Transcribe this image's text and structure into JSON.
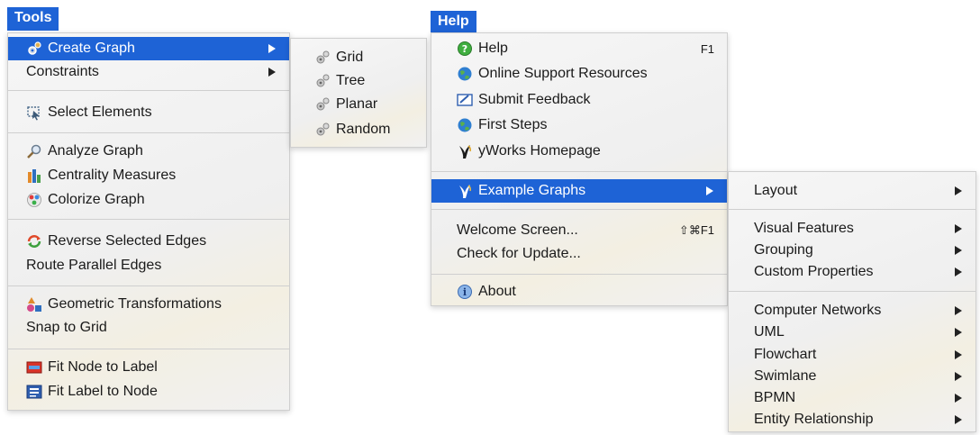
{
  "tools_menu": {
    "title": "Tools",
    "items": [
      {
        "label": "Create Graph",
        "icon": "gears-icon"
      },
      {
        "label": "Constraints"
      },
      {
        "label": "Select Elements",
        "icon": "select-icon"
      },
      {
        "label": "Analyze Graph",
        "icon": "magnifier-icon"
      },
      {
        "label": "Centrality Measures",
        "icon": "bars-icon"
      },
      {
        "label": "Colorize Graph",
        "icon": "palette-icon"
      },
      {
        "label": "Reverse Selected Edges",
        "icon": "reverse-icon"
      },
      {
        "label": "Route Parallel Edges"
      },
      {
        "label": "Geometric Transformations",
        "icon": "shapes-icon"
      },
      {
        "label": "Snap to Grid"
      },
      {
        "label": "Fit Node to Label",
        "icon": "fit-node-icon"
      },
      {
        "label": "Fit Label to Node",
        "icon": "fit-label-icon"
      }
    ]
  },
  "create_graph_submenu": {
    "items": [
      {
        "label": "Grid"
      },
      {
        "label": "Tree"
      },
      {
        "label": "Planar"
      },
      {
        "label": "Random"
      }
    ]
  },
  "help_menu": {
    "title": "Help",
    "items": [
      {
        "label": "Help",
        "shortcut": "F1",
        "icon": "help-icon"
      },
      {
        "label": "Online Support Resources",
        "icon": "globe-icon"
      },
      {
        "label": "Submit Feedback",
        "icon": "feedback-icon"
      },
      {
        "label": "First Steps",
        "icon": "globe-icon"
      },
      {
        "label": "yWorks Homepage",
        "icon": "yworks-logo-icon"
      },
      {
        "label": "Example Graphs",
        "icon": "yworks-logo-icon"
      },
      {
        "label": "Welcome Screen...",
        "shortcut": "⇧⌘F1"
      },
      {
        "label": "Check for Update..."
      },
      {
        "label": "About",
        "icon": "info-icon"
      }
    ]
  },
  "example_graphs_submenu": {
    "items": [
      {
        "label": "Layout"
      },
      {
        "label": "Visual Features"
      },
      {
        "label": "Grouping"
      },
      {
        "label": "Custom Properties"
      },
      {
        "label": "Computer Networks"
      },
      {
        "label": "UML"
      },
      {
        "label": "Flowchart"
      },
      {
        "label": "Swimlane"
      },
      {
        "label": "BPMN"
      },
      {
        "label": "Entity Relationship"
      }
    ]
  },
  "colors": {
    "selection": "#1e63d6",
    "menu_background": "#f2f2f2",
    "separator": "#cfcfcf"
  }
}
